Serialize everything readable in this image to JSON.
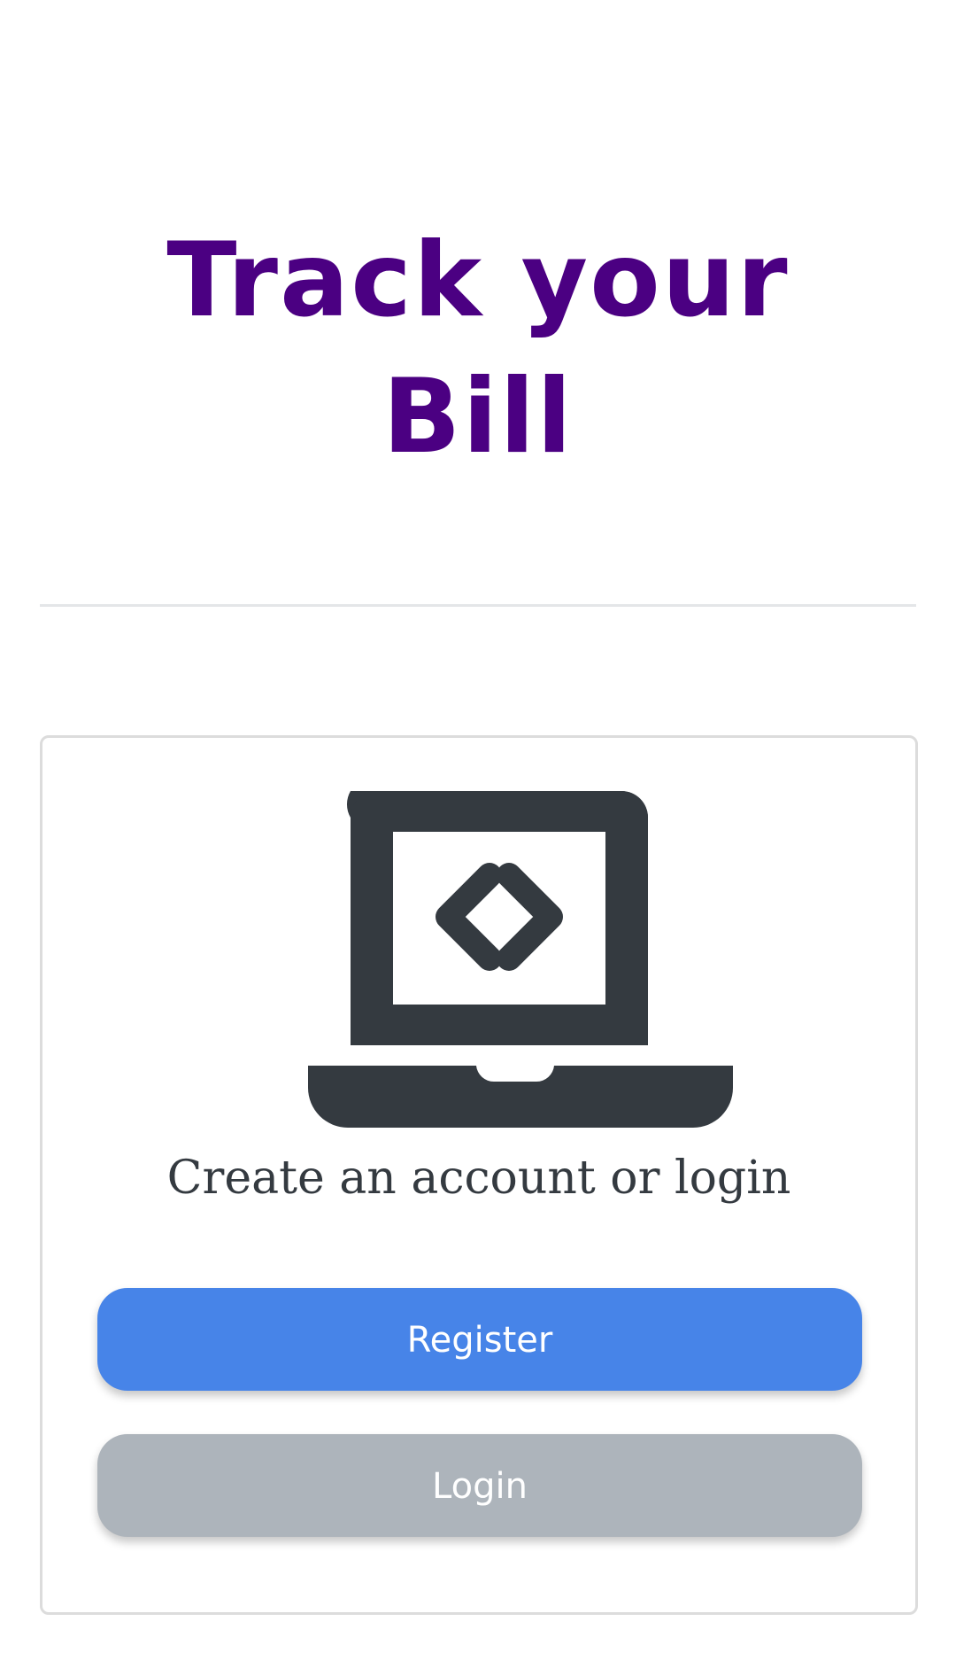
{
  "header": {
    "title_line1": "Track your",
    "title_line2": "Bill"
  },
  "card": {
    "icon": "laptop-code-icon",
    "subtitle": "Create an account or login",
    "register_label": "Register",
    "login_label": "Login"
  },
  "colors": {
    "title": "#4b0082",
    "register_button": "#4784e8",
    "login_button": "#adb4bb",
    "icon": "#343a40"
  }
}
